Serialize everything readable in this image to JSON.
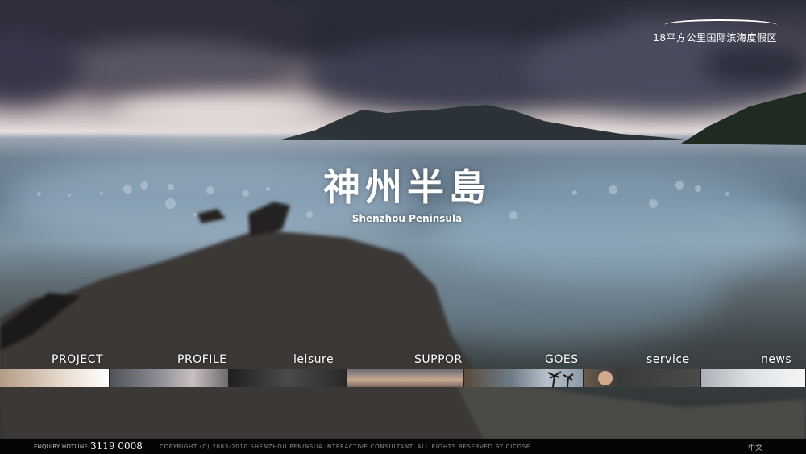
{
  "top_logo": {
    "text": "18平方公里国际滨海度假区"
  },
  "brand": {
    "chinese_name": "神州半島",
    "english_name": "Shenzhou Peninsula"
  },
  "nav": {
    "items": [
      {
        "label": "PROJECT"
      },
      {
        "label": "PROFILE"
      },
      {
        "label": "leisure"
      },
      {
        "label": "SUPPOR"
      },
      {
        "label": "GOES"
      },
      {
        "label": "service"
      },
      {
        "label": "news"
      }
    ]
  },
  "footer": {
    "hotline_label": "ENQUIRY HOTLINE",
    "hotline_number": "3119 0008",
    "copyright": "COPYRIGHT (C) 2003-2010 SHENZHOU PENINSUA INTERACTIVE CONSULTANT. ALL RIGHTS RESERVED BY CICOSE.",
    "language_link": "中文"
  }
}
